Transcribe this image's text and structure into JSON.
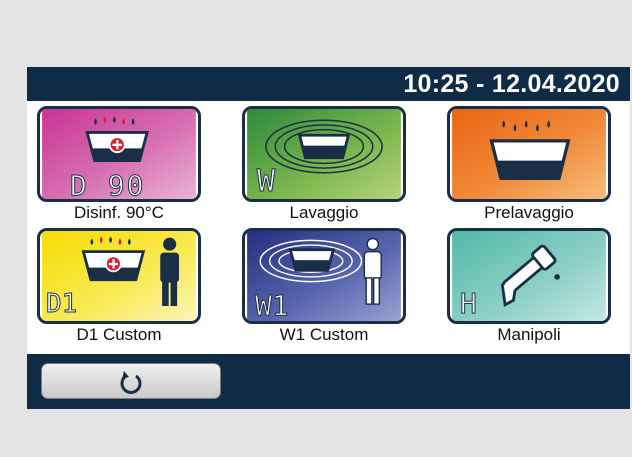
{
  "header": {
    "clock": "10:25 - 12.04.2020"
  },
  "programs": [
    {
      "id": "disinfection",
      "label": "Disinf. 90°C",
      "badge": "D 90",
      "icon": "disinfection-basin-icon",
      "bg_top": "#cf3e9b",
      "bg_bottom": "#e6a6cf"
    },
    {
      "id": "wash",
      "label": "Lavaggio",
      "badge": "W",
      "icon": "wash-basin-waves-icon",
      "bg_top": "#2e8a3a",
      "bg_bottom": "#a9cf6c"
    },
    {
      "id": "prewash",
      "label": "Prelavaggio",
      "badge": "",
      "icon": "prewash-basin-icon",
      "bg_top": "#ea6b14",
      "bg_bottom": "#f6b773"
    },
    {
      "id": "d1-custom",
      "label": "D1 Custom",
      "badge": "D1",
      "icon": "custom-disinfection-person-icon",
      "bg_top": "#f7e000",
      "bg_bottom": "#fbf1a0"
    },
    {
      "id": "w1-custom",
      "label": "W1 Custom",
      "badge": "W1",
      "icon": "custom-wash-person-icon",
      "bg_top": "#2b3a8f",
      "bg_bottom": "#8a94c9"
    },
    {
      "id": "handles",
      "label": "Manipoli",
      "badge": "H",
      "icon": "handpiece-icon",
      "bg_top": "#5bbfad",
      "bg_bottom": "#b7e1dc"
    }
  ],
  "footer": {
    "back_icon": "rotate-back-icon"
  }
}
